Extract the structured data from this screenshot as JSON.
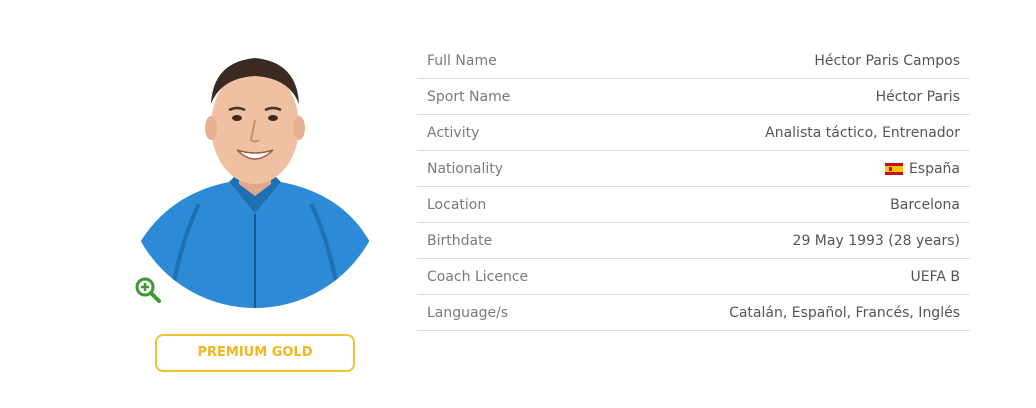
{
  "profile": {
    "photo_icon": "player-portrait",
    "zoom_icon": "zoom-in-icon",
    "badge_label": "PREMIUM GOLD",
    "badge_color": "#f2c12e"
  },
  "details": [
    {
      "label": "Full Name",
      "value": "Héctor Paris Campos"
    },
    {
      "label": "Sport Name",
      "value": "Héctor Paris"
    },
    {
      "label": "Activity",
      "value": "Analista táctico, Entrenador"
    },
    {
      "label": "Nationality",
      "value": "España",
      "flag_icon": "spain-flag-icon"
    },
    {
      "label": "Location",
      "value": "Barcelona"
    },
    {
      "label": "Birthdate",
      "value": "29 May 1993 (28 years)"
    },
    {
      "label": "Coach Licence",
      "value": "UEFA B"
    },
    {
      "label": "Language/s",
      "value": "Catalán, Español, Francés, Inglés"
    }
  ]
}
